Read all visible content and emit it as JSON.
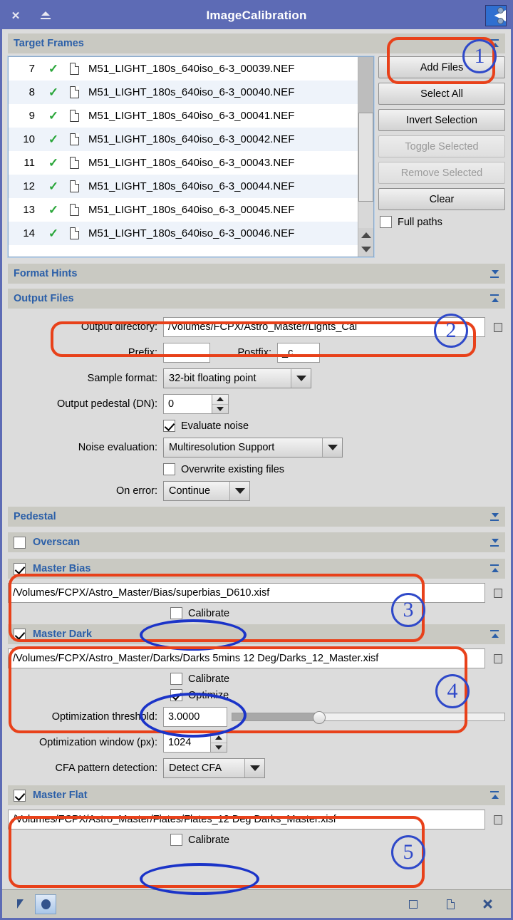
{
  "window": {
    "title": "ImageCalibration",
    "close_icon": "close-icon",
    "rollup_icon": "collapse-icon",
    "process_icon": "imagecalibration-process-icon"
  },
  "sections": {
    "target_frames": {
      "title": "Target Frames",
      "arrow": "collapse-arrow-up"
    },
    "format_hints": {
      "title": "Format Hints",
      "arrow": "expand-arrow-down"
    },
    "output_files": {
      "title": "Output Files",
      "arrow": "collapse-arrow-up"
    },
    "pedestal": {
      "title": "Pedestal",
      "arrow": "expand-arrow-down"
    },
    "overscan": {
      "title": "Overscan",
      "arrow": "expand-arrow-down",
      "checked": false
    },
    "master_bias": {
      "title": "Master Bias",
      "arrow": "collapse-arrow-up",
      "checked": true
    },
    "master_dark": {
      "title": "Master Dark",
      "arrow": "collapse-arrow-up",
      "checked": true
    },
    "master_flat": {
      "title": "Master Flat",
      "arrow": "collapse-arrow-up",
      "checked": true
    }
  },
  "target_frames": {
    "columns": [
      "#",
      "enabled",
      "file"
    ],
    "rows": [
      {
        "index": "7",
        "check": "✓",
        "name": "M51_LIGHT_180s_640iso_6-3_00039.NEF"
      },
      {
        "index": "8",
        "check": "✓",
        "name": "M51_LIGHT_180s_640iso_6-3_00040.NEF"
      },
      {
        "index": "9",
        "check": "✓",
        "name": "M51_LIGHT_180s_640iso_6-3_00041.NEF"
      },
      {
        "index": "10",
        "check": "✓",
        "name": "M51_LIGHT_180s_640iso_6-3_00042.NEF"
      },
      {
        "index": "11",
        "check": "✓",
        "name": "M51_LIGHT_180s_640iso_6-3_00043.NEF"
      },
      {
        "index": "12",
        "check": "✓",
        "name": "M51_LIGHT_180s_640iso_6-3_00044.NEF"
      },
      {
        "index": "13",
        "check": "✓",
        "name": "M51_LIGHT_180s_640iso_6-3_00045.NEF"
      },
      {
        "index": "14",
        "check": "✓",
        "name": "M51_LIGHT_180s_640iso_6-3_00046.NEF"
      }
    ],
    "buttons": [
      {
        "label": "Add Files",
        "enabled": true
      },
      {
        "label": "Select All",
        "enabled": true
      },
      {
        "label": "Invert Selection",
        "enabled": true
      },
      {
        "label": "Toggle Selected",
        "enabled": false
      },
      {
        "label": "Remove Selected",
        "enabled": false
      },
      {
        "label": "Clear",
        "enabled": true
      }
    ],
    "full_paths": {
      "label": "Full paths",
      "checked": false
    }
  },
  "output_files": {
    "output_directory": {
      "label": "Output directory:",
      "value": "/Volumes/FCPX/Astro_Master/Lights_Cal"
    },
    "prefix": {
      "label": "Prefix:",
      "value": ""
    },
    "postfix": {
      "label": "Postfix:",
      "value": "_c"
    },
    "sample_format": {
      "label": "Sample format:",
      "value": "32-bit floating point"
    },
    "output_pedestal": {
      "label": "Output pedestal (DN):",
      "value": "0"
    },
    "evaluate_noise": {
      "label": "Evaluate noise",
      "checked": true
    },
    "noise_evaluation": {
      "label": "Noise evaluation:",
      "value": "Multiresolution Support"
    },
    "overwrite": {
      "label": "Overwrite existing files",
      "checked": false
    },
    "on_error": {
      "label": "On error:",
      "value": "Continue"
    }
  },
  "master_bias": {
    "path": "/Volumes/FCPX/Astro_Master/Bias/superbias_D610.xisf",
    "calibrate": {
      "label": "Calibrate",
      "checked": false
    }
  },
  "master_dark": {
    "path": "/Volumes/FCPX/Astro_Master/Darks/Darks 5mins 12 Deg/Darks_12_Master.xisf",
    "calibrate": {
      "label": "Calibrate",
      "checked": false
    },
    "optimize": {
      "label": "Optimize",
      "checked": true
    },
    "optimization_threshold": {
      "label": "Optimization threshold:",
      "value": "3.0000",
      "slider_percent": 32
    },
    "optimization_window": {
      "label": "Optimization window (px):",
      "value": "1024"
    },
    "cfa_pattern_detection": {
      "label": "CFA pattern detection:",
      "value": "Detect CFA"
    }
  },
  "master_flat": {
    "path": "/Volumes/FCPX/Astro_Master/Flates/Flates_12 Deg Darks_Master.xisf",
    "calibrate": {
      "label": "Calibrate",
      "checked": false
    }
  },
  "bottom_bar": {
    "left": [
      {
        "icon": "arrow-pointer-icon",
        "selected": false
      },
      {
        "icon": "apply-global-icon",
        "selected": true
      }
    ],
    "right": [
      {
        "icon": "new-instance-icon"
      },
      {
        "icon": "browse-documentation-icon"
      },
      {
        "icon": "reset-icon"
      }
    ]
  },
  "annotations": [
    {
      "number": "1",
      "target": "add-files-button"
    },
    {
      "number": "2",
      "target": "output-directory-field"
    },
    {
      "number": "3",
      "target": "master-bias-path-field"
    },
    {
      "number": "4",
      "target": "master-dark-path-field"
    },
    {
      "number": "5",
      "target": "master-flat-path-field"
    }
  ],
  "colors": {
    "titlebar": "#5d6bb5",
    "section_header": "#c9c9c2",
    "section_title_text": "#2b5fa8",
    "dialog_bg": "#dcdcdc",
    "annotation_rect": "#e8411a",
    "annotation_ellipse": "#1b34c8",
    "check_green": "#2aa63a"
  }
}
